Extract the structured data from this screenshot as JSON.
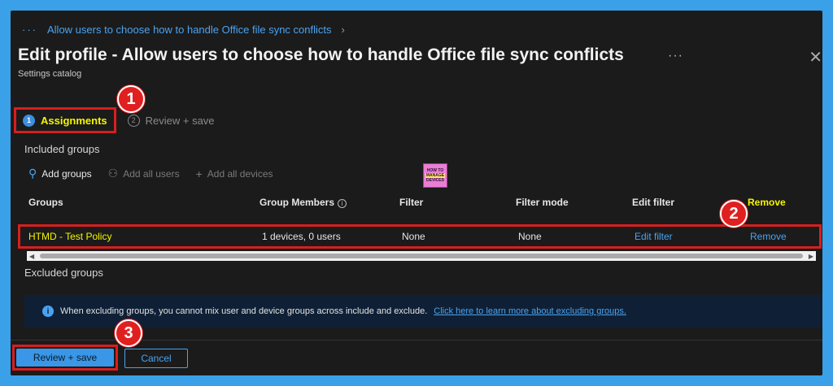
{
  "breadcrumb": {
    "ellipsis": "···",
    "current": "Allow users to choose how to handle Office file sync conflicts"
  },
  "header": {
    "title": "Edit profile - Allow users to choose how to handle Office file sync conflicts",
    "more": "···",
    "close": "✕",
    "subtitle": "Settings catalog"
  },
  "steps": [
    {
      "num": "1",
      "label": "Assignments"
    },
    {
      "num": "2",
      "label": "Review + save"
    }
  ],
  "callouts": [
    "1",
    "2",
    "3"
  ],
  "included": {
    "heading": "Included groups",
    "actions": {
      "add_groups": "Add groups",
      "add_all_users": "Add all users",
      "add_all_devices": "Add all devices"
    }
  },
  "logo": {
    "top": "HOW TO",
    "mid": "MANAGE",
    "bottom": "DEVICES"
  },
  "table": {
    "columns": [
      "Groups",
      "Group Members",
      "Filter",
      "Filter mode",
      "Edit filter",
      "Remove"
    ],
    "rows": [
      {
        "group": "HTMD - Test Policy",
        "members": "1 devices, 0 users",
        "filter": "None",
        "mode": "None",
        "edit": "Edit filter",
        "remove": "Remove"
      }
    ]
  },
  "excluded": {
    "heading": "Excluded groups",
    "info_text": "When excluding groups, you cannot mix user and device groups across include and exclude.",
    "info_link": "Click here to learn more about excluding groups."
  },
  "footer": {
    "review_save": "Review + save",
    "cancel": "Cancel"
  },
  "colors": {
    "accent": "#3a96e6",
    "highlight": "#f5f500",
    "callout": "#e02020",
    "background": "#1b1b1b"
  }
}
